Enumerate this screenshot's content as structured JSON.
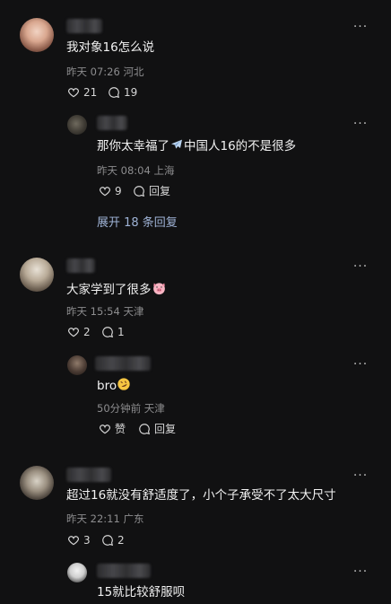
{
  "comments": [
    {
      "text": "我对象16怎么说",
      "meta": "昨天 07:26 河北",
      "likes": "21",
      "replies": "19",
      "reply": {
        "text_before": "那你太幸福了",
        "text_after": "中国人16的不是很多",
        "meta": "昨天 08:04 上海",
        "likes": "9",
        "reply_label": "回复",
        "expand_label": "展开 18 条回复"
      }
    },
    {
      "text": "大家学到了很多",
      "meta": "昨天 15:54 天津",
      "likes": "2",
      "replies": "1",
      "reply": {
        "text": "bro",
        "meta": "50分钟前 天津",
        "likes_label": "赞",
        "reply_label": "回复"
      }
    },
    {
      "text": "超过16就没有舒适度了，小个子承受不了太大尺寸",
      "meta": "昨天 22:11 广东",
      "likes": "3",
      "replies": "2",
      "reply": {
        "text": "15就比较舒服呗"
      }
    }
  ],
  "icons": {
    "more": "more-dots-icon",
    "like": "heart-icon",
    "comment": "comment-bubble-icon",
    "airplane": "airplane-emoji",
    "pig": "pig-face-emoji",
    "laugh": "rolling-laugh-emoji"
  },
  "colors": {
    "background": "#111112",
    "link": "#9fb3d6",
    "meta": "#8d8d8f"
  }
}
